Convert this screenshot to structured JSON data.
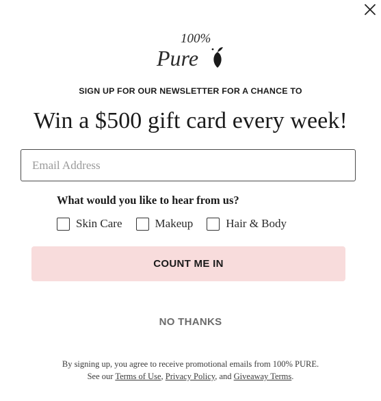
{
  "modal": {
    "close_icon": "close-icon",
    "logo": {
      "top_text": "100%",
      "script_text": "Pure"
    },
    "eyebrow": "SIGN UP FOR OUR NEWSLETTER FOR A CHANCE TO",
    "headline": "Win a $500 gift card every week!",
    "email": {
      "placeholder": "Email Address",
      "value": ""
    },
    "question": "What would you like to hear from us?",
    "options": [
      {
        "label": "Skin Care",
        "checked": false
      },
      {
        "label": "Makeup",
        "checked": false
      },
      {
        "label": "Hair & Body",
        "checked": false
      }
    ],
    "submit_label": "COUNT ME IN",
    "decline_label": "NO THANKS",
    "disclaimer": {
      "line1": "By signing up, you agree to receive promotional emails from 100% PURE.",
      "see_our": "See our",
      "terms_link": "Terms of Use",
      "sep1": ",",
      "privacy_link": "Privacy Policy",
      "and": ", and",
      "giveaway_link": "Giveaway Terms",
      "end": "."
    },
    "colors": {
      "button_bg": "#f8dcdc",
      "text": "#1a1a1a",
      "muted": "#6b6b6b"
    }
  }
}
